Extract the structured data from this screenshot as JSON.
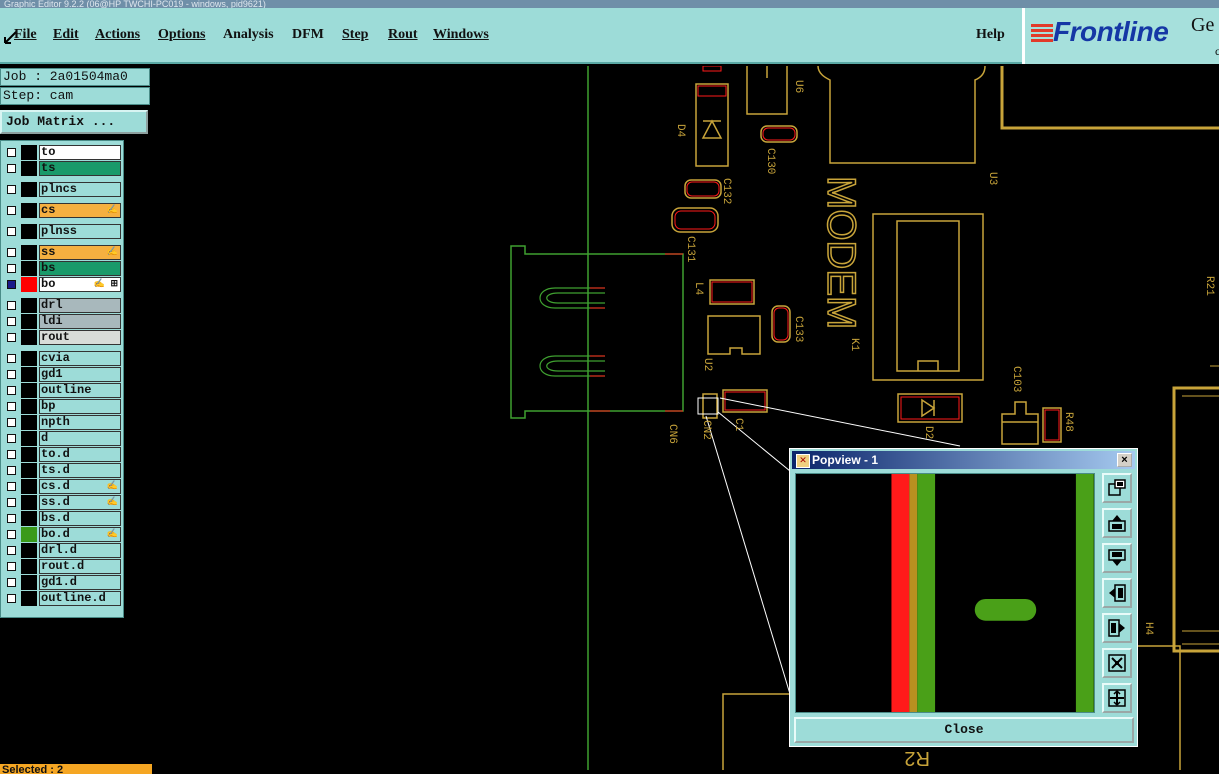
{
  "window_title": "Graphic Editor 9.2.2 (06@HP TWCHI-PC019 - windows, pid9621)",
  "menu": {
    "file": "File",
    "edit": "Edit",
    "actions": "Actions",
    "options": "Options",
    "analysis": "Analysis",
    "dfm": "DFM",
    "step": "Step",
    "rout": "Rout",
    "windows": "Windows",
    "help": "Help"
  },
  "logo": {
    "brand": "Frontline",
    "ge": "Ge",
    "small": "c"
  },
  "job": {
    "job_line": "Job : 2a01504ma0",
    "step_line": "Step: cam",
    "matrix_button": "Job Matrix ..."
  },
  "layers": [
    {
      "name": "to",
      "color": "#ffffff",
      "swatch": "#000000",
      "mark": ""
    },
    {
      "name": "ts",
      "color": "#1a9a6a",
      "swatch": "#000000",
      "mark": ""
    },
    {
      "name": "plncs",
      "color": "#9ddcd8",
      "swatch": "#000000",
      "mark": ""
    },
    {
      "name": "cs",
      "color": "#f5b040",
      "swatch": "#000000",
      "mark": "✍"
    },
    {
      "name": "plnss",
      "color": "#9ddcd8",
      "swatch": "#000000",
      "mark": ""
    },
    {
      "name": "ss",
      "color": "#f5b040",
      "swatch": "#000000",
      "mark": "✍"
    },
    {
      "name": "bs",
      "color": "#1a9a6a",
      "swatch": "#000000",
      "mark": ""
    },
    {
      "name": "bo",
      "color": "#ffffff",
      "swatch": "#ff0000",
      "mark": "✍ ⊞"
    },
    {
      "name": "drl",
      "color": "#a8b8bc",
      "swatch": "#000000",
      "mark": ""
    },
    {
      "name": "ldi",
      "color": "#a8b8bc",
      "swatch": "#000000",
      "mark": ""
    },
    {
      "name": "rout",
      "color": "#d8dcd8",
      "swatch": "#000000",
      "mark": ""
    },
    {
      "name": "cvia",
      "color": "#9ddcd8",
      "swatch": "#000000",
      "mark": ""
    },
    {
      "name": "gd1",
      "color": "#9ddcd8",
      "swatch": "#000000",
      "mark": ""
    },
    {
      "name": "outline",
      "color": "#9ddcd8",
      "swatch": "#000000",
      "mark": ""
    },
    {
      "name": "bp",
      "color": "#9ddcd8",
      "swatch": "#000000",
      "mark": ""
    },
    {
      "name": "npth",
      "color": "#9ddcd8",
      "swatch": "#000000",
      "mark": ""
    },
    {
      "name": "d",
      "color": "#9ddcd8",
      "swatch": "#000000",
      "mark": ""
    },
    {
      "name": "to.d",
      "color": "#9ddcd8",
      "swatch": "#000000",
      "mark": ""
    },
    {
      "name": "ts.d",
      "color": "#9ddcd8",
      "swatch": "#000000",
      "mark": ""
    },
    {
      "name": "cs.d",
      "color": "#9ddcd8",
      "swatch": "#000000",
      "mark": "✍"
    },
    {
      "name": "ss.d",
      "color": "#9ddcd8",
      "swatch": "#000000",
      "mark": "✍"
    },
    {
      "name": "bs.d",
      "color": "#9ddcd8",
      "swatch": "#000000",
      "mark": ""
    },
    {
      "name": "bo.d",
      "color": "#9ddcd8",
      "swatch": "#3a9a1a",
      "mark": "✍"
    },
    {
      "name": "drl.d",
      "color": "#9ddcd8",
      "swatch": "#000000",
      "mark": ""
    },
    {
      "name": "rout.d",
      "color": "#9ddcd8",
      "swatch": "#000000",
      "mark": ""
    },
    {
      "name": "gd1.d",
      "color": "#9ddcd8",
      "swatch": "#000000",
      "mark": ""
    },
    {
      "name": "outline.d",
      "color": "#9ddcd8",
      "swatch": "#000000",
      "mark": ""
    }
  ],
  "selected": "Selected : 2",
  "board_labels": {
    "u6": "U6",
    "d4": "D4",
    "c130": "C130",
    "c132": "C132",
    "c131": "C131",
    "u3": "U3",
    "modem": "MODEM",
    "k1": "K1",
    "l4": "L4",
    "c133": "C133",
    "u2": "U2",
    "cn6": "CN6",
    "cn2": "CN2",
    "c103": "C103",
    "r48": "R48",
    "d2": "D2",
    "r21": "R21",
    "h4": "H4",
    "r2": "R2",
    "cl": "C1"
  },
  "popview": {
    "title": "Popview - 1",
    "close_x": "×",
    "close_button": "Close"
  },
  "colors": {
    "outline": "#c8a43a",
    "copper": "#c8a43a",
    "red": "#ff1a1a",
    "green": "#4aa018",
    "green_line": "#3fa030"
  }
}
